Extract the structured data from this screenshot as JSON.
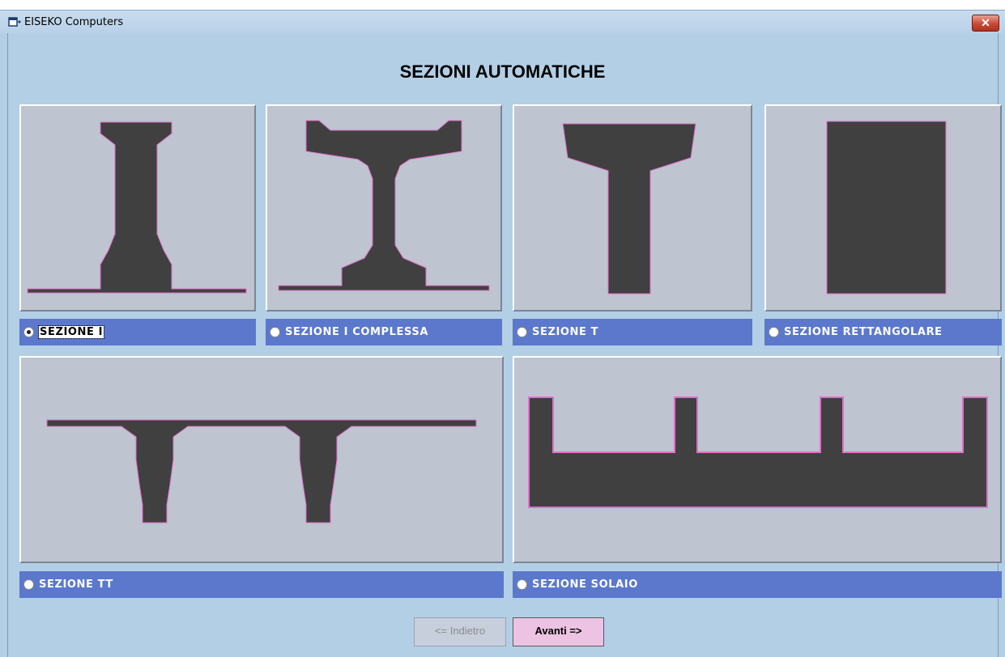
{
  "window": {
    "title": "EISEKO Computers",
    "close_label": "✕"
  },
  "page_title": "SEZIONI AUTOMATICHE",
  "options": {
    "sezione_i": {
      "label": "SEZIONE I",
      "selected": true
    },
    "sezione_i_complessa": {
      "label": "SEZIONE I COMPLESSA",
      "selected": false
    },
    "sezione_t": {
      "label": "SEZIONE T",
      "selected": false
    },
    "sezione_rettangolare": {
      "label": "SEZIONE RETTANGOLARE",
      "selected": false
    },
    "sezione_tt": {
      "label": "SEZIONE TT",
      "selected": false
    },
    "sezione_solaio": {
      "label": "SEZIONE SOLAIO",
      "selected": false
    }
  },
  "buttons": {
    "back": "<= Indietro",
    "next": "Avanti =>"
  },
  "colors": {
    "section_fill": "#404040",
    "section_outline": "#e070c8",
    "option_bar": "#5b78cd",
    "panel_bg": "#bec4d0"
  }
}
